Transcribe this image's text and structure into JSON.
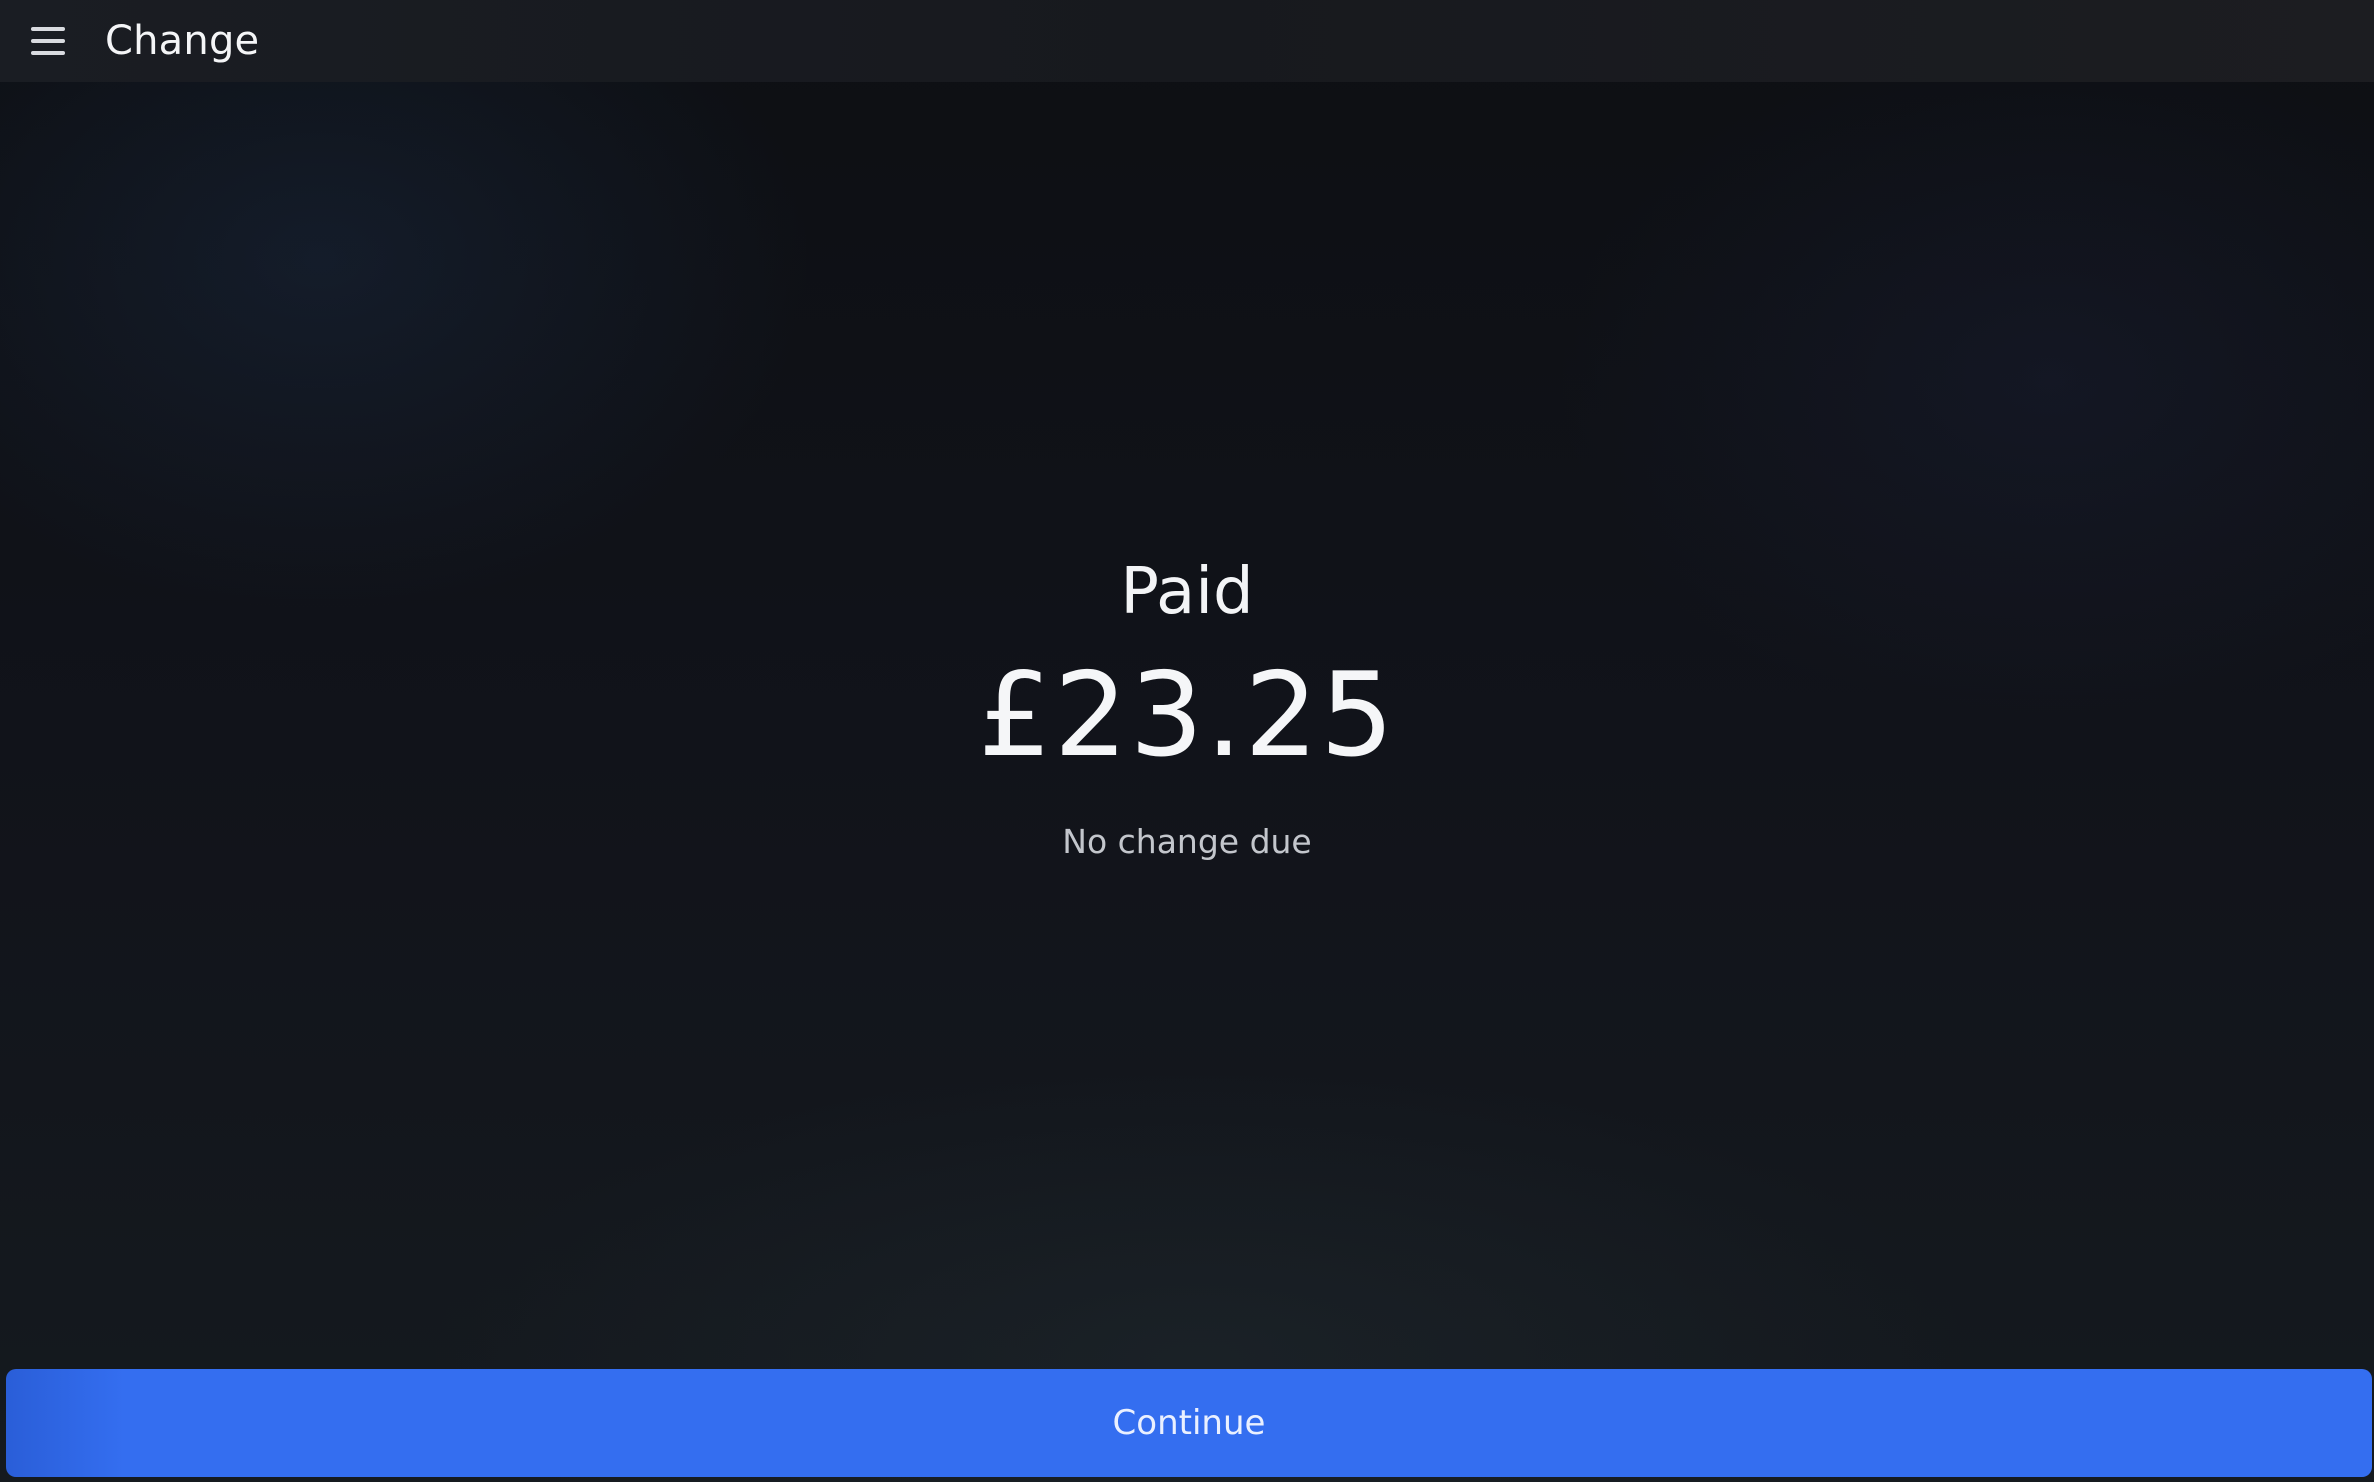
{
  "header": {
    "menu_icon": "hamburger-menu-icon",
    "title": "Change"
  },
  "payment": {
    "paid_label": "Paid",
    "amount": "£23.25",
    "change_note": "No change due"
  },
  "footer": {
    "continue_label": "Continue"
  },
  "colors": {
    "primary_button": "#346ef0",
    "background": "#0f1116",
    "topbar": "#1a1d23",
    "text": "#f2f3f5",
    "muted_text": "#c3c6cc"
  }
}
